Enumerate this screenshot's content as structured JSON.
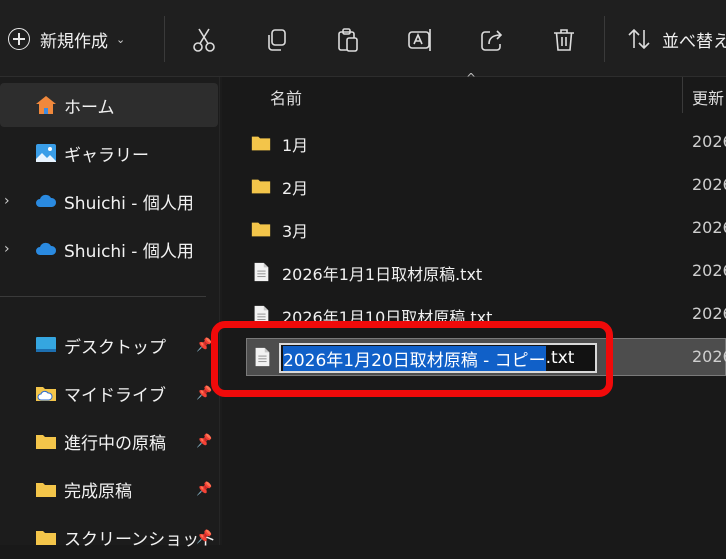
{
  "toolbar": {
    "new_label": "新規作成",
    "new_chevron": "⌄",
    "icons": [
      "cut-icon",
      "copy-icon",
      "paste-icon",
      "rename-icon",
      "share-icon",
      "delete-icon"
    ],
    "sort_label": "並べ替え"
  },
  "sidebar": {
    "items": [
      {
        "label": "ホーム",
        "icon": "home-icon",
        "active": true
      },
      {
        "label": "ギャラリー",
        "icon": "gallery-icon"
      },
      {
        "label": "Shuichi - 個人用",
        "icon": "onedrive-icon",
        "expander": "›"
      },
      {
        "label": "Shuichi - 個人用",
        "icon": "onedrive-icon",
        "expander": "›"
      },
      {
        "label": "デスクトップ",
        "icon": "desktop-icon",
        "pinned": true
      },
      {
        "label": "マイドライブ",
        "icon": "drive-folder-icon",
        "pinned": true
      },
      {
        "label": "進行中の原稿",
        "icon": "folder-icon",
        "pinned": true
      },
      {
        "label": "完成原稿",
        "icon": "folder-icon",
        "pinned": true
      },
      {
        "label": "スクリーンショット",
        "icon": "folder-icon",
        "pinned": true
      }
    ]
  },
  "list": {
    "columns": {
      "name": "名前",
      "date": "更新日時"
    },
    "rows": [
      {
        "name": "1月",
        "type": "folder",
        "date": "2026"
      },
      {
        "name": "2月",
        "type": "folder",
        "date": "2026"
      },
      {
        "name": "3月",
        "type": "folder",
        "date": "2026"
      },
      {
        "name": "2026年1月1日取材原稿.txt",
        "type": "file",
        "date": "2026"
      },
      {
        "name": "2026年1月10日取材原稿.txt",
        "type": "file",
        "date": "2026"
      }
    ],
    "renaming": {
      "selected_part": "2026年1月20日取材原稿 - コピー",
      "rest": ".txt",
      "date": "2026"
    }
  },
  "colors": {
    "highlight": "#f00a0a",
    "selection": "#1060c8",
    "folder": "#f3c54a"
  }
}
